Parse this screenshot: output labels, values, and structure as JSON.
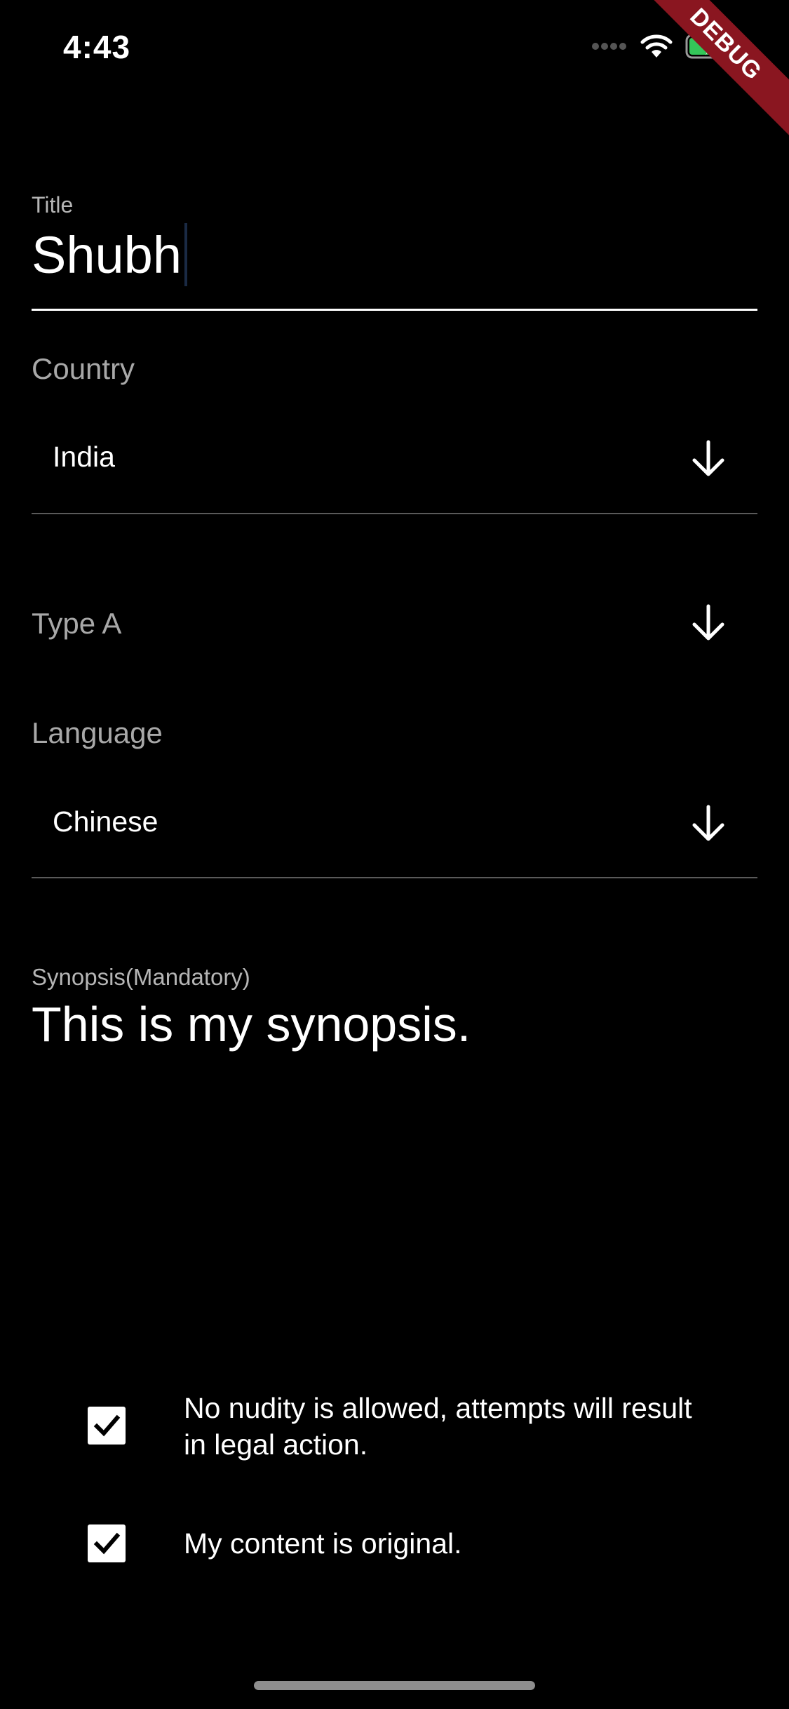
{
  "status_bar": {
    "time": "4:43",
    "debug_label": "DEBUG",
    "icons": [
      "signal-dots-icon",
      "wifi-icon",
      "battery-charging-icon"
    ]
  },
  "form": {
    "title": {
      "label": "Title",
      "value": "Shubh"
    },
    "country": {
      "label": "Country",
      "value": "India"
    },
    "type": {
      "label": "Type A"
    },
    "language": {
      "label": "Language",
      "value": "Chinese"
    },
    "synopsis": {
      "label": "Synopsis(Mandatory)",
      "value": "This is my synopsis."
    }
  },
  "agreements": [
    {
      "text": "No nudity is allowed, attempts will result in legal action.",
      "checked": true
    },
    {
      "text": "My content is original.",
      "checked": true
    }
  ],
  "colors": {
    "background": "#000000",
    "text": "#ffffff",
    "muted_text": "#a8a8a8",
    "debug_banner": "#8a1620",
    "battery_fill": "#34c759"
  }
}
